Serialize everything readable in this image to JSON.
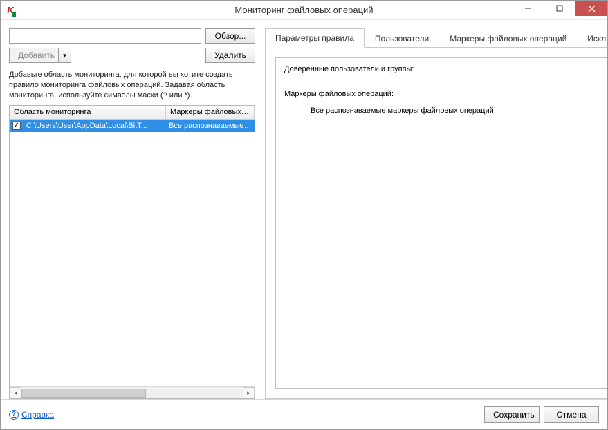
{
  "window": {
    "title": "Мониторинг файловых операций"
  },
  "left": {
    "browse_label": "Обзор...",
    "add_label": "Добавить",
    "delete_label": "Удалить",
    "help_text": "Добавьте область мониторинга, для которой вы хотите создать правило мониторинга файловых операций. Задавая область мониторинга, используйте символы маски (? или *).",
    "path_value": "",
    "columns": {
      "area": "Область мониторинга",
      "markers": "Маркеры файловых опе"
    },
    "rows": [
      {
        "checked": true,
        "area": "C:\\Users\\User\\AppData\\Local\\BitT...",
        "markers": "Все распознаваемые мар"
      }
    ]
  },
  "tabs": {
    "rule_params": "Параметры правила",
    "users": "Пользователи",
    "markers": "Маркеры файловых операций",
    "exclusions": "Исключени"
  },
  "details": {
    "trusted_label": "Доверенные пользователи и группы:",
    "markers_label": "Маркеры файловых операций:",
    "markers_value": "Все распознаваемые маркеры файловых операций"
  },
  "footer": {
    "help": "Справка",
    "save": "Сохранить",
    "cancel": "Отмена"
  }
}
